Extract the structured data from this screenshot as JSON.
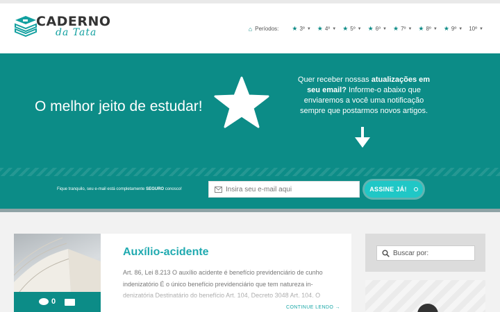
{
  "header": {
    "logo": {
      "word1": "CADERNO",
      "word2": "da Tata"
    },
    "nav": {
      "label": "Períodos:",
      "items": [
        "3º",
        "4º",
        "5º",
        "6º",
        "7º",
        "8º",
        "9º",
        "10º"
      ]
    }
  },
  "hero": {
    "title": "O melhor jeito de estudar!",
    "text_prefix": "Quer receber nossas ",
    "text_bold": "atualizações em seu email?",
    "text_suffix": " Informe-o abaixo que enviaremos a você uma notificação sempre que postarmos novos artigos.",
    "form_note_prefix": "Fique tranquilo, seu e-mail está completamente ",
    "form_note_bold": "SEGURO",
    "form_note_suffix": " conosco!",
    "email_placeholder": "Insira seu e-mail aqui",
    "subscribe_label": "ASSINE JÁ!"
  },
  "post": {
    "title": "Auxílio-acidente",
    "excerpt": "Art. 86, Lei 8.213 O auxílio acidente é benefício previdenciário de cunho indenizatório É o único benefício previdenciário que tem natureza in-denizatória Destinatário do benefício Art. 104, Decreto 3048 Art. 104.  O",
    "comments": "0",
    "read_more": "CONTINUE LENDO →"
  },
  "sidebar": {
    "search_placeholder": "Buscar por:"
  },
  "colors": {
    "accent": "#0c8c87",
    "button": "#20c7c6",
    "link": "#20aab0"
  }
}
